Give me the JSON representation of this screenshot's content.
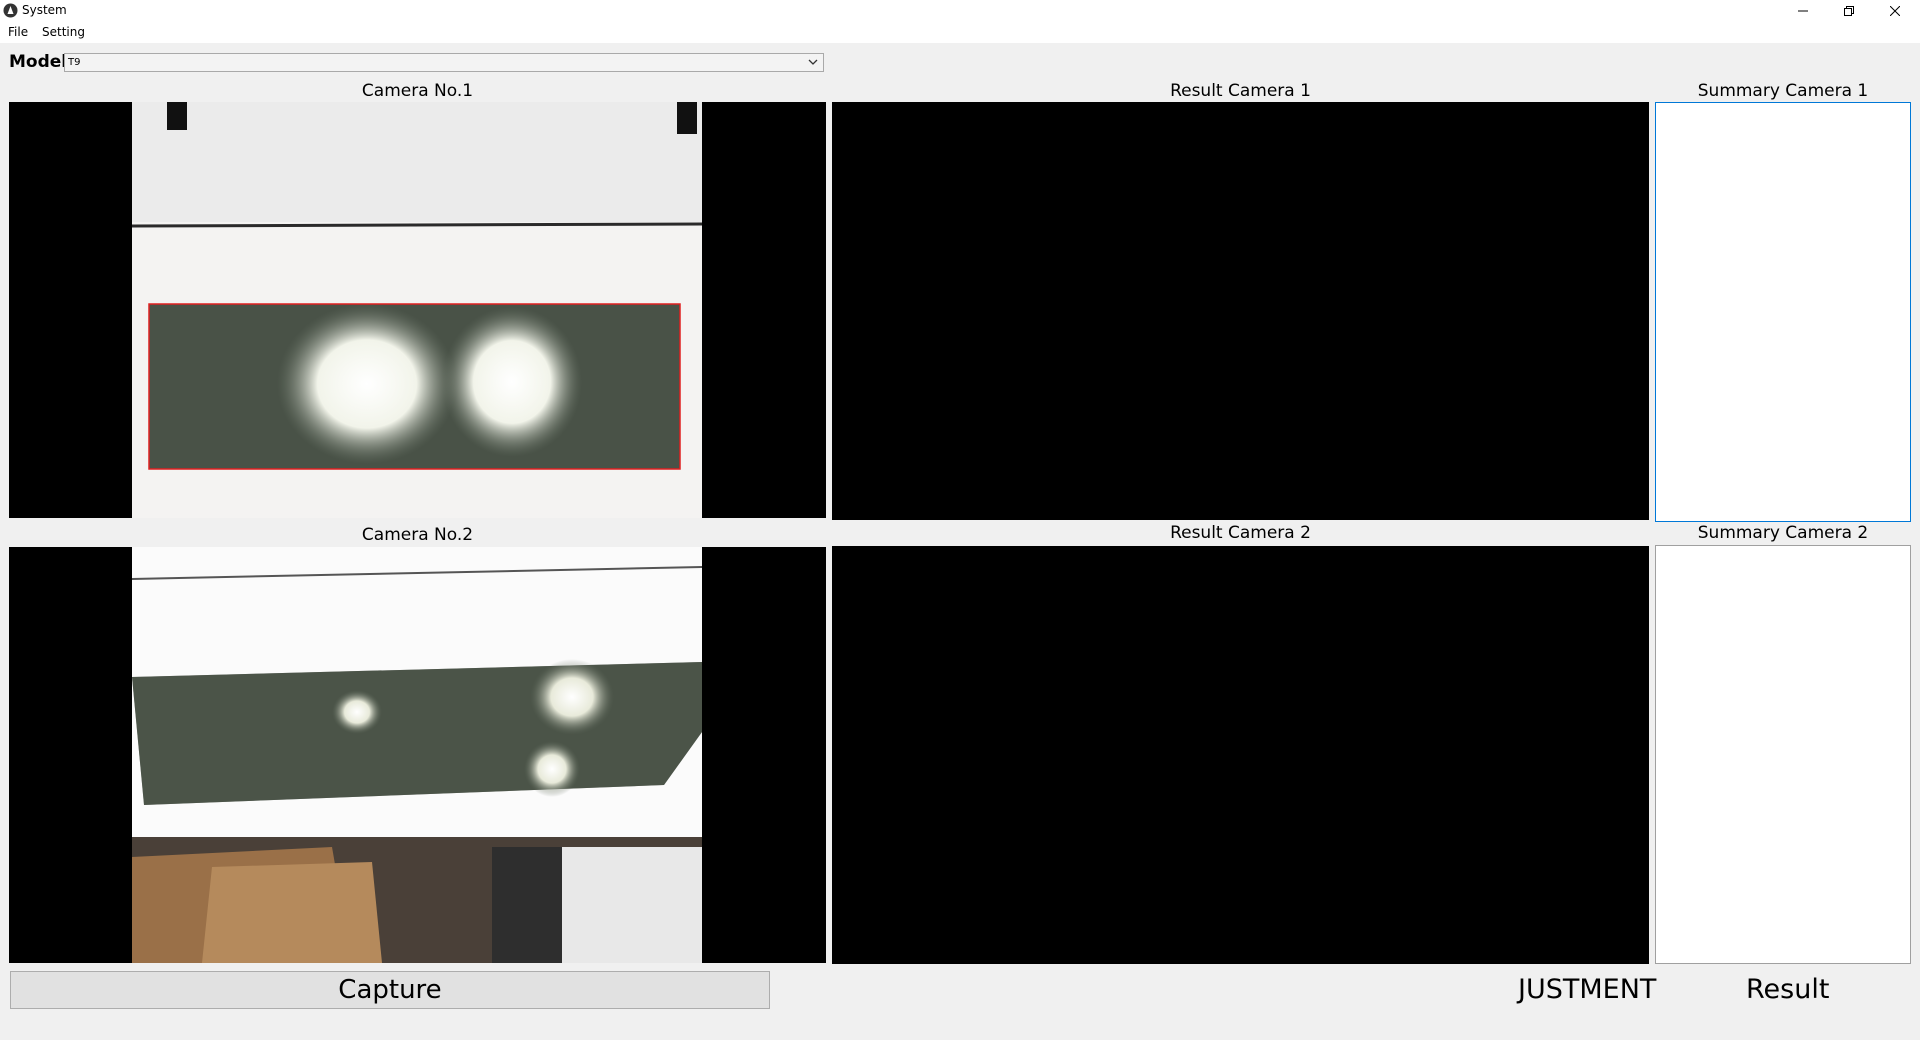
{
  "window": {
    "title": "System",
    "controls": [
      "minimize-icon",
      "restore-icon",
      "close-icon"
    ]
  },
  "menu": {
    "items": [
      {
        "label": "File"
      },
      {
        "label": "Setting"
      }
    ]
  },
  "model": {
    "label": "Model",
    "selected": "T9"
  },
  "panels": {
    "camera1": {
      "title": "Camera No.1"
    },
    "camera2": {
      "title": "Camera No.2"
    },
    "result1": {
      "title": "Result Camera 1"
    },
    "result2": {
      "title": "Result Camera 2"
    },
    "summary1": {
      "title": "Summary Camera 1"
    },
    "summary2": {
      "title": "Summary Camera 2"
    }
  },
  "actions": {
    "capture_label": "Capture"
  },
  "status": {
    "adjustment_text": "JUSTMENT",
    "result_text": "Result"
  },
  "colors": {
    "background": "#f0f0f0",
    "focus_border": "#0078d7",
    "roi_box": "#e02020"
  }
}
